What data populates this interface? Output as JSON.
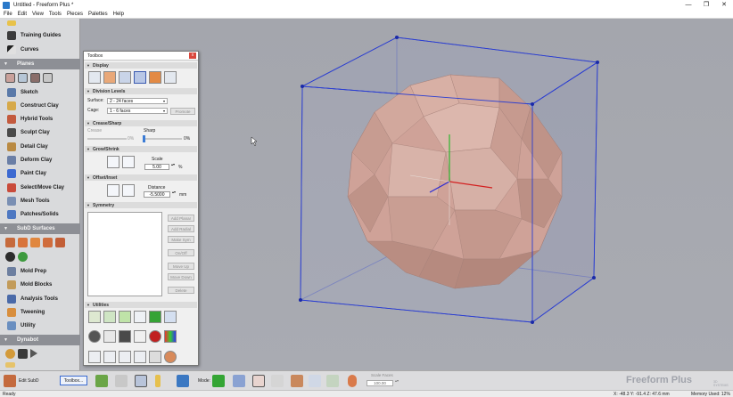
{
  "window": {
    "title": "Untitled - Freeform Plus *",
    "minimize": "—",
    "maximize": "❐",
    "close": "✕"
  },
  "menu": [
    "File",
    "Edit",
    "View",
    "Tools",
    "Pieces",
    "Palettes",
    "Help"
  ],
  "sidebar": {
    "items_top": [
      {
        "label": "Training Guides",
        "icon": "graduation-cap-icon"
      },
      {
        "label": "Curves",
        "icon": "curve-icon"
      }
    ],
    "planes_header": "Planes",
    "items_mid": [
      {
        "label": "Sketch",
        "icon": "sketch-icon"
      },
      {
        "label": "Construct Clay",
        "icon": "construct-clay-icon"
      },
      {
        "label": "Hybrid Tools",
        "icon": "hybrid-tools-icon"
      },
      {
        "label": "Sculpt Clay",
        "icon": "sculpt-clay-icon"
      },
      {
        "label": "Detail Clay",
        "icon": "detail-clay-icon"
      },
      {
        "label": "Deform Clay",
        "icon": "deform-clay-icon"
      },
      {
        "label": "Paint Clay",
        "icon": "paint-clay-icon"
      },
      {
        "label": "Select/Move Clay",
        "icon": "select-move-icon"
      },
      {
        "label": "Mesh Tools",
        "icon": "mesh-tools-icon"
      },
      {
        "label": "Patches/Solids",
        "icon": "patches-solids-icon"
      }
    ],
    "subd_header": "SubD Surfaces",
    "items_bottom": [
      {
        "label": "Mold Prep",
        "icon": "mold-prep-icon"
      },
      {
        "label": "Mold Blocks",
        "icon": "mold-blocks-icon"
      },
      {
        "label": "Analysis Tools",
        "icon": "analysis-tools-icon"
      },
      {
        "label": "Tweening",
        "icon": "tweening-icon"
      },
      {
        "label": "Utility",
        "icon": "utility-icon"
      }
    ],
    "dynabot_header": "Dynabot"
  },
  "toolbox": {
    "title": "Toolbox",
    "close": "x",
    "sections": {
      "display": "Display",
      "division_levels": "Division Levels",
      "crease_sharp": "Crease/Sharp",
      "grow_shrink": "Grow/Shrink",
      "offset_inset": "Offset/Inset",
      "symmetry": "Symmetry",
      "utilities": "Utilities"
    },
    "surface_label": "Surface:",
    "surface_value": "2 - 24 faces",
    "cage_label": "Cage:",
    "cage_value": "1 - 6 faces",
    "promote_button": "Promote",
    "crease_label": "Crease",
    "sharp_label": "Sharp",
    "crease_value": "0%",
    "sharp_value": "0%",
    "scale_label": "Scale",
    "scale_value": "5.00",
    "scale_unit": "%",
    "distance_label": "Distance",
    "distance_value": "-5.5000",
    "distance_unit": "mm",
    "symmetry_buttons": [
      "Add Planar",
      "Add Radial",
      "Make Sym",
      "On/Off",
      "Move Up",
      "Move Down",
      "Delete"
    ]
  },
  "bottombar": {
    "edit_subd": "Edit SubD",
    "toolbox_button": "Toolbox...",
    "mode_label": "Mode:",
    "scale_faces_label": "Scale Faces",
    "scale_faces_value": "100.00",
    "logo_text": "Freeform Plus",
    "logo_sub": "3D SYSTEMS"
  },
  "status": {
    "left": "Ready",
    "coords": "X: -48.3  Y: -91.4  Z: 47.6   mm",
    "memory": "Memory Used: 12%"
  },
  "colors": {
    "accent_blue": "#2b4bd6",
    "clay": "#cfa298",
    "viewport_bg": "#a7a9b0"
  }
}
